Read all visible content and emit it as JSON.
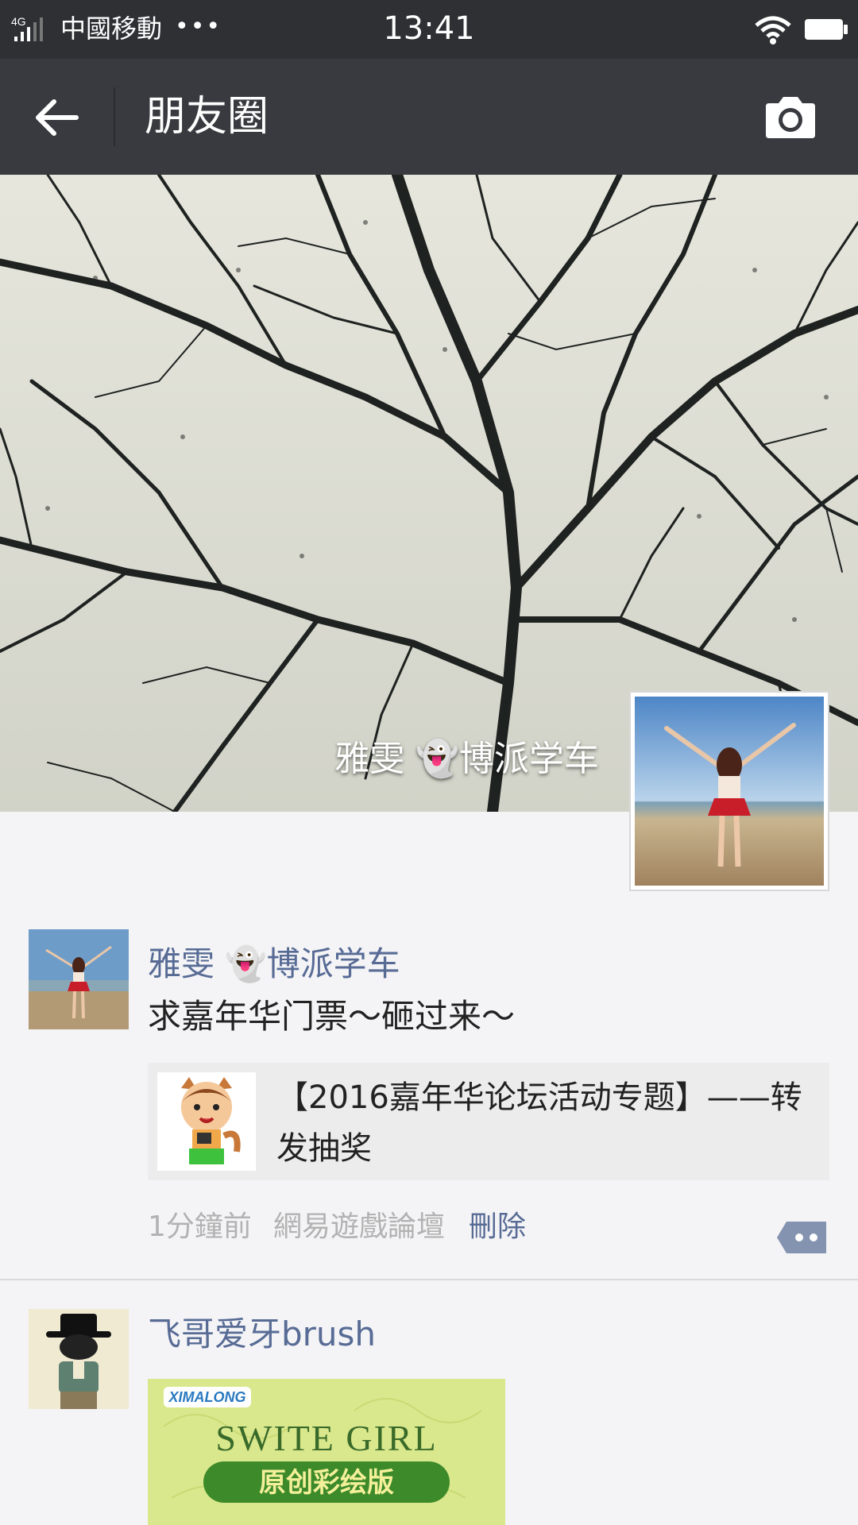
{
  "status_bar": {
    "network": "4G",
    "carrier": "中國移動",
    "more": "•••",
    "time": "13:41"
  },
  "nav": {
    "title": "朋友圈"
  },
  "cover": {
    "name": "雅雯 👻博派学车"
  },
  "posts": [
    {
      "name": "雅雯 👻博派学车",
      "text": "求嘉年华门票～砸过来～",
      "share_title": "【2016嘉年华论坛活动专题】——转发抽奖",
      "time": "1分鐘前",
      "source": "網易遊戲論壇",
      "delete": "刪除"
    },
    {
      "name": "飞哥爱牙brush",
      "image_brand": "XIMALONG",
      "image_title": "SWITE GIRL",
      "image_subtitle": "原创彩绘版"
    }
  ],
  "colors": {
    "status_bar": "#2e3034",
    "nav_bar": "#393a3f",
    "link": "#576b95",
    "meta": "#b2b2b2"
  }
}
